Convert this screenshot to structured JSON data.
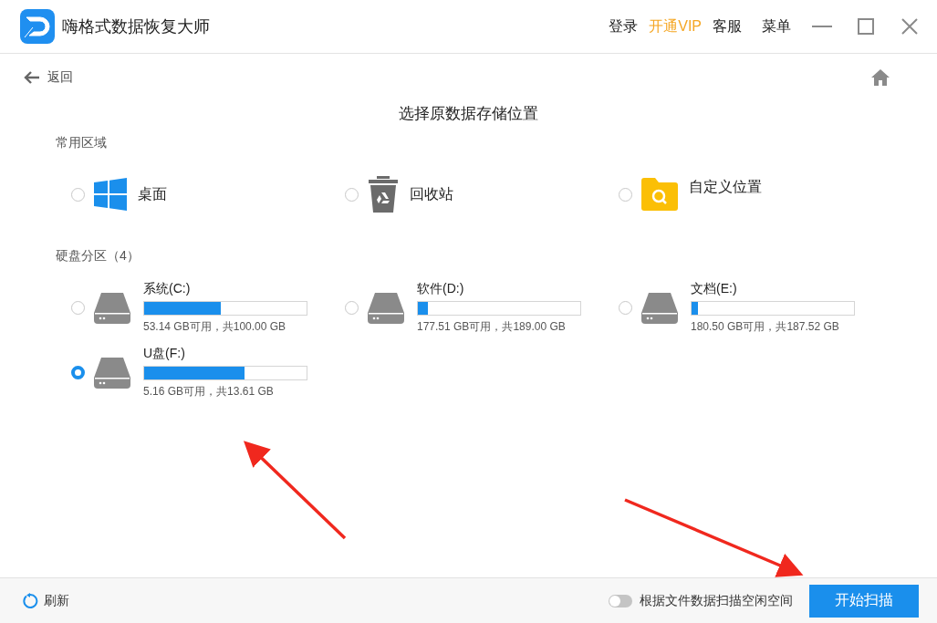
{
  "window": {
    "title": "嗨格式数据恢复大师",
    "menu": [
      {
        "label": "登录",
        "kind": "plain"
      },
      {
        "label": "开通VIP",
        "kind": "vip"
      },
      {
        "label": "客服",
        "kind": "plain"
      },
      {
        "label": "菜单",
        "kind": "plain"
      }
    ]
  },
  "back": {
    "label": "返回"
  },
  "heading": "选择原数据存储位置",
  "common": {
    "title": "常用区域",
    "items": [
      {
        "label": "桌面",
        "kind": "windows",
        "selected": false
      },
      {
        "label": "回收站",
        "kind": "recycle",
        "selected": false
      },
      {
        "label": "自定义位置",
        "kind": "folder",
        "selected": false
      }
    ]
  },
  "drives": {
    "title": "硬盘分区（4）",
    "items": [
      {
        "name": "系统(C:)",
        "info": "53.14 GB可用，共100.00 GB",
        "level": 0.47,
        "selected": false
      },
      {
        "name": "软件(D:)",
        "info": "177.51 GB可用，共189.00 GB",
        "level": 0.06,
        "selected": false
      },
      {
        "name": "文档(E:)",
        "info": "180.50 GB可用，共187.52 GB",
        "level": 0.04,
        "selected": false
      },
      {
        "name": "U盘(F:)",
        "info": "5.16 GB可用，共13.61 GB",
        "level": 0.62,
        "selected": true
      }
    ]
  },
  "footer": {
    "refresh": "刷新",
    "toggle": {
      "label": "根据文件数据扫描空闲空间",
      "on": false
    },
    "start": "开始扫描"
  }
}
